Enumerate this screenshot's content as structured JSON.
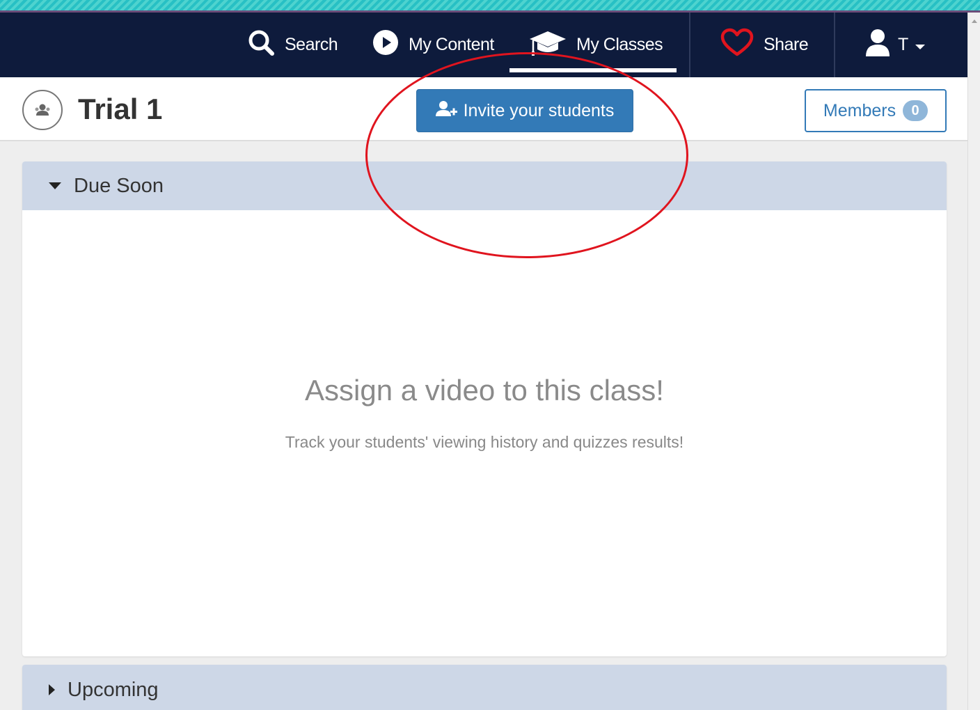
{
  "nav": {
    "search_label": "Search",
    "content_label": "My Content",
    "classes_label": "My Classes",
    "share_label": "Share",
    "user_initial": "T",
    "active_item": "My Classes",
    "accent_colors": {
      "navbar_bg": "#0e1b3c",
      "share_heart": "#e0141e"
    }
  },
  "class": {
    "title": "Trial 1",
    "invite_button_label": "Invite your students",
    "members_label": "Members",
    "members_count": "0"
  },
  "panels": {
    "due_soon": {
      "label": "Due Soon",
      "expanded": true,
      "empty_title": "Assign a video to this class!",
      "empty_subtitle": "Track your students' viewing history and quizzes results!"
    },
    "upcoming": {
      "label": "Upcoming",
      "expanded": false
    }
  },
  "annotation": {
    "shape": "ellipse",
    "color": "#e0141e"
  },
  "icons": [
    "search-icon",
    "play-icon",
    "graduation-cap-icon",
    "heart-icon",
    "user-icon",
    "caret-down-icon",
    "add-user-icon",
    "class-avatar-icon",
    "caret-right-icon"
  ]
}
